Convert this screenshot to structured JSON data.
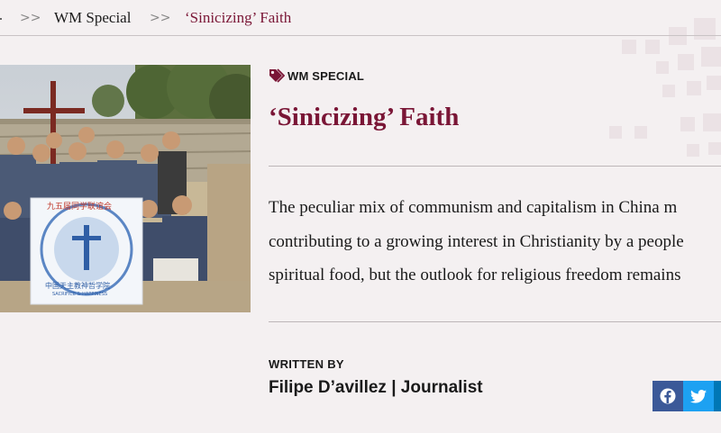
{
  "breadcrumb": {
    "items": [
      {
        "label": "WM Special"
      },
      {
        "label": "‘Sinicizing’ Faith"
      }
    ],
    "separator": ">>"
  },
  "article": {
    "tag": "WM SPECIAL",
    "title": "‘Sinicizing’ Faith",
    "lead_lines": [
      "The peculiar mix of communism and capitalism in China m",
      "contributing to a growing interest in Christianity by a people",
      "spiritual food, but the outlook for religious freedom remains"
    ],
    "written_by_label": "WRITTEN BY",
    "author": "Filipe D’avillez | Journalist",
    "photo_banner_top": "九五届同学联谊会",
    "photo_banner_bottom": "中国天主教神哲学院",
    "photo_banner_motto": "SACRIFICE & HAPPINESS"
  },
  "share": {
    "facebook_icon": "facebook-icon",
    "twitter_icon": "twitter-icon"
  },
  "colors": {
    "accent": "#7a1636",
    "background": "#f4f0f1",
    "facebook": "#3b5998",
    "twitter": "#1da1f2",
    "linkedin": "#0077b5"
  }
}
